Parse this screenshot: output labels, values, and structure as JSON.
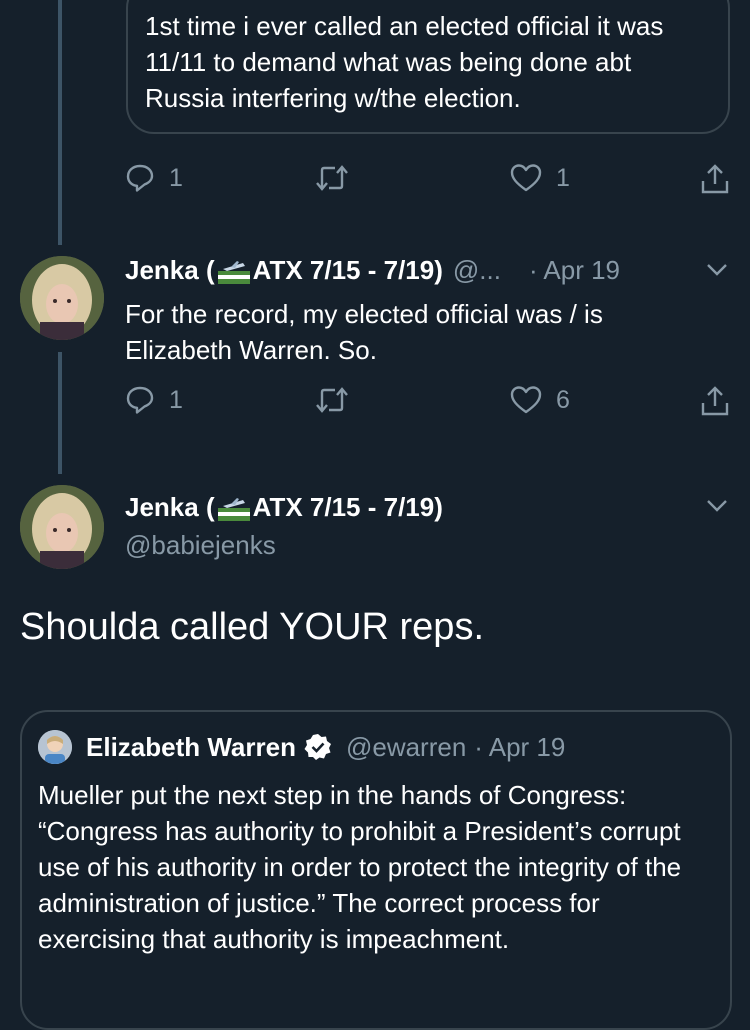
{
  "top_quote": {
    "text": "1st time i ever called an elected official it was 11/11 to demand what was being done abt Russia interfering w/the election."
  },
  "actions_1": {
    "replies": "1",
    "likes": "1"
  },
  "tweet_2": {
    "name_prefix": "Jenka (",
    "name_suffix": "ATX 7/15 - 7/19)",
    "handle_truncated": "@...",
    "date": "· Apr 19",
    "text": "For the record, my elected official was / is Elizabeth Warren. So."
  },
  "actions_2": {
    "replies": "1",
    "likes": "6"
  },
  "tweet_3": {
    "name_prefix": "Jenka (",
    "name_suffix": "ATX 7/15 - 7/19)",
    "handle": "@babiejenks",
    "text": "Shoulda called YOUR reps."
  },
  "quoted_tweet": {
    "name": "Elizabeth Warren",
    "handle": "@ewarren",
    "date": "· Apr 19",
    "text": "Mueller put the next step in the hands of Congress: “Congress has authority to prohibit a President’s corrupt use of his authority in order to protect the integrity of the administration of justice.” The correct process for exercising that authority is impeachment."
  },
  "icons": {
    "reply": "reply-icon",
    "retweet": "retweet-icon",
    "like": "heart-icon",
    "share": "share-icon",
    "menu": "chevron-down-icon",
    "verified": "verified-badge-icon",
    "flag": "flag-icon"
  },
  "colors": {
    "background": "#15202b",
    "text": "#ffffff",
    "secondary": "#8899a6",
    "border": "#38444d",
    "thread_line": "#3d5466"
  }
}
